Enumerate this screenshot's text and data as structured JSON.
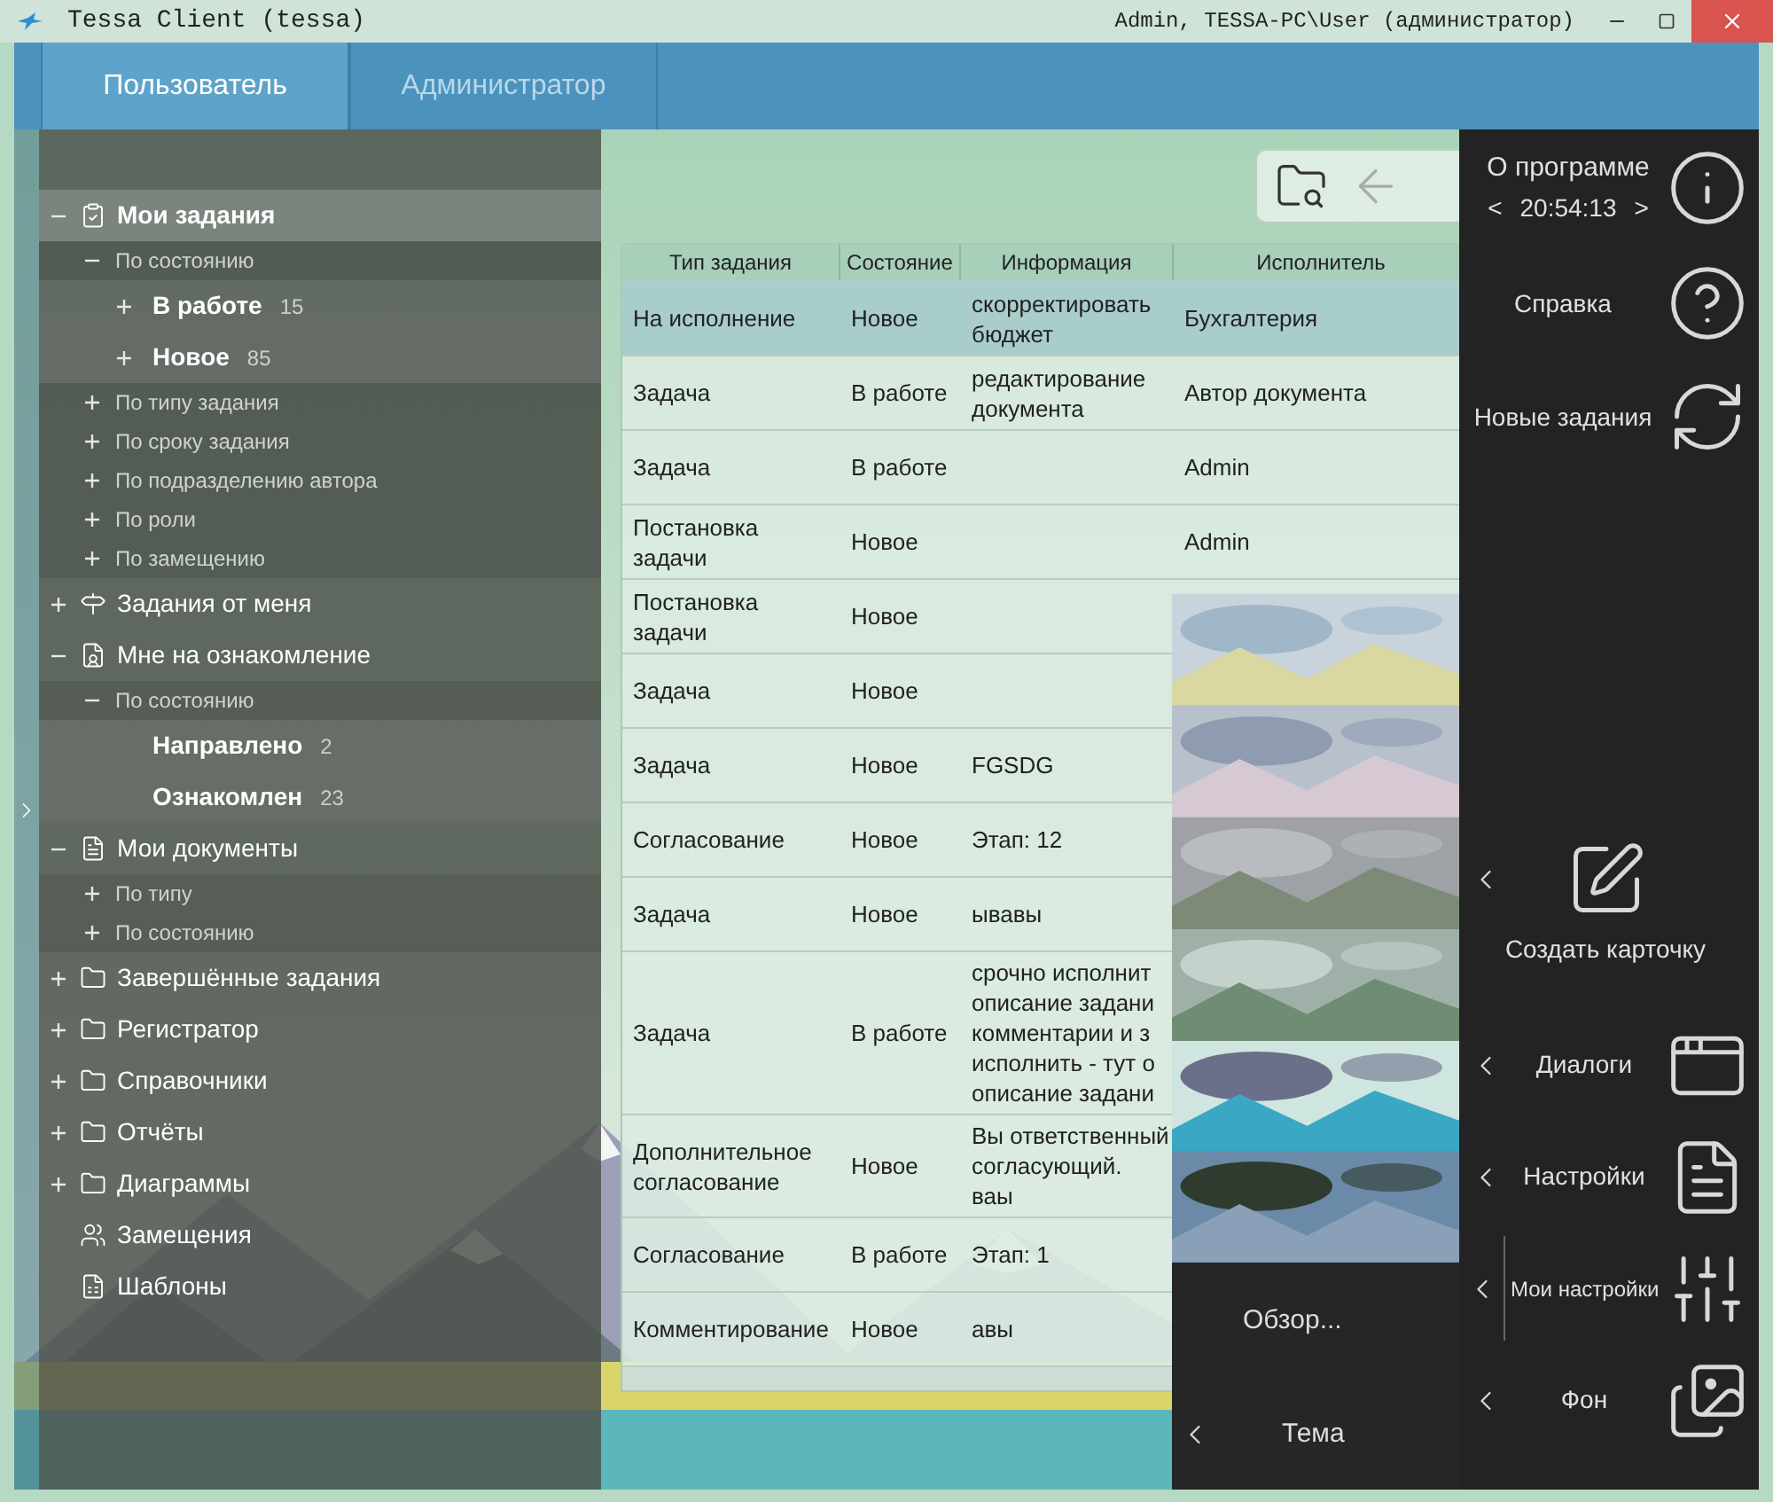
{
  "window": {
    "title": "Tessa Client (tessa)",
    "user": "Admin, TESSA-PC\\User (администратор)"
  },
  "tabs": [
    {
      "label": "Пользователь",
      "selected": true
    },
    {
      "label": "Администратор",
      "selected": false
    }
  ],
  "tree": [
    {
      "label": "Мои задания",
      "expanded": true,
      "selected": true,
      "children": [
        {
          "label": "По состоянию",
          "expanded": true,
          "selected": false,
          "children": [
            {
              "label": "В работе",
              "count": "15",
              "expanded": false,
              "selected": false
            },
            {
              "label": "Новое",
              "count": "85",
              "expanded": false,
              "selected": false
            }
          ]
        },
        {
          "label": "По типу задания",
          "expanded": false,
          "selected": false
        },
        {
          "label": "По сроку задания",
          "expanded": false,
          "selected": false
        },
        {
          "label": "По подразделению автора",
          "expanded": false,
          "selected": false
        },
        {
          "label": "По роли",
          "expanded": false,
          "selected": false
        },
        {
          "label": "По замещению",
          "expanded": false,
          "selected": false
        }
      ]
    },
    {
      "label": "Задания от меня",
      "expanded": false,
      "selected": false
    },
    {
      "label": "Мне на ознакомление",
      "expanded": true,
      "selected": false,
      "children": [
        {
          "label": "По состоянию",
          "expanded": true,
          "selected": false,
          "children": [
            {
              "label": "Направлено",
              "count": "2",
              "selected": false
            },
            {
              "label": "Ознакомлен",
              "count": "23",
              "selected": false
            }
          ]
        }
      ]
    },
    {
      "label": "Мои документы",
      "expanded": true,
      "selected": false,
      "children": [
        {
          "label": "По типу",
          "expanded": false,
          "selected": false
        },
        {
          "label": "По состоянию",
          "expanded": false,
          "selected": false
        }
      ]
    },
    {
      "label": "Завершённые задания",
      "expanded": false,
      "selected": false
    },
    {
      "label": "Регистратор",
      "expanded": false,
      "selected": false
    },
    {
      "label": "Справочники",
      "expanded": false,
      "selected": false
    },
    {
      "label": "Отчёты",
      "expanded": false,
      "selected": false
    },
    {
      "label": "Диаграммы",
      "expanded": false,
      "selected": false
    },
    {
      "label": "Замещения",
      "selected": false
    },
    {
      "label": "Шаблоны",
      "selected": false
    }
  ],
  "table": {
    "columns": [
      "Тип задания",
      "Состояние",
      "Информация",
      "Исполнитель"
    ],
    "rows": [
      {
        "type": "На исполнение",
        "status": "Новое",
        "info": "скорректировать бюджет",
        "executor": "Бухгалтерия",
        "selected": true
      },
      {
        "type": "Задача",
        "status": "В работе",
        "info": "редактирование документа",
        "executor": "Автор документа",
        "selected": false
      },
      {
        "type": "Задача",
        "status": "В работе",
        "executor": "Admin",
        "selected": false
      },
      {
        "type": "Постановка задачи",
        "status": "Новое",
        "executor": "Admin",
        "selected": false
      },
      {
        "type": "Постановка задачи",
        "status": "Новое",
        "selected": false
      },
      {
        "type": "Задача",
        "status": "Новое",
        "selected": false
      },
      {
        "type": "Задача",
        "status": "Новое",
        "info": "FGSDG",
        "selected": false
      },
      {
        "type": "Согласование",
        "status": "Новое",
        "info": "Этап: 12",
        "selected": false
      },
      {
        "type": "Задача",
        "status": "Новое",
        "info": "ывавы",
        "selected": false
      },
      {
        "type": "Задача",
        "status": "В работе",
        "info": "срочно исполнит\nописание задани\nкомментарии и з\nисполнить - тут о\nописание задани",
        "selected": false
      },
      {
        "type": "Дополнительное согласование",
        "status": "Новое",
        "info": "Вы ответственный\nсогласующий.\nваы",
        "selected": false
      },
      {
        "type": "Согласование",
        "status": "В работе",
        "info": "Этап: 1",
        "selected": false
      },
      {
        "type": "Комментирование",
        "status": "Новое",
        "info": "авы",
        "selected": false
      }
    ]
  },
  "theme_flyout": {
    "browse": "Обзор...",
    "theme": "Тема"
  },
  "side_panel": [
    {
      "kind": "about",
      "label": "О программе",
      "prev": "<",
      "time": "20:54:13",
      "next": ">"
    },
    {
      "kind": "plain",
      "label": "Справка"
    },
    {
      "kind": "plain",
      "label": "Новые задания"
    },
    {
      "kind": "tile",
      "label": "Создать карточку"
    },
    {
      "kind": "submenu",
      "label": "Диалоги"
    },
    {
      "kind": "submenu",
      "label": "Настройки"
    },
    {
      "kind": "split",
      "label": "Мои настройки"
    },
    {
      "kind": "submenu",
      "label": "Фон"
    }
  ]
}
